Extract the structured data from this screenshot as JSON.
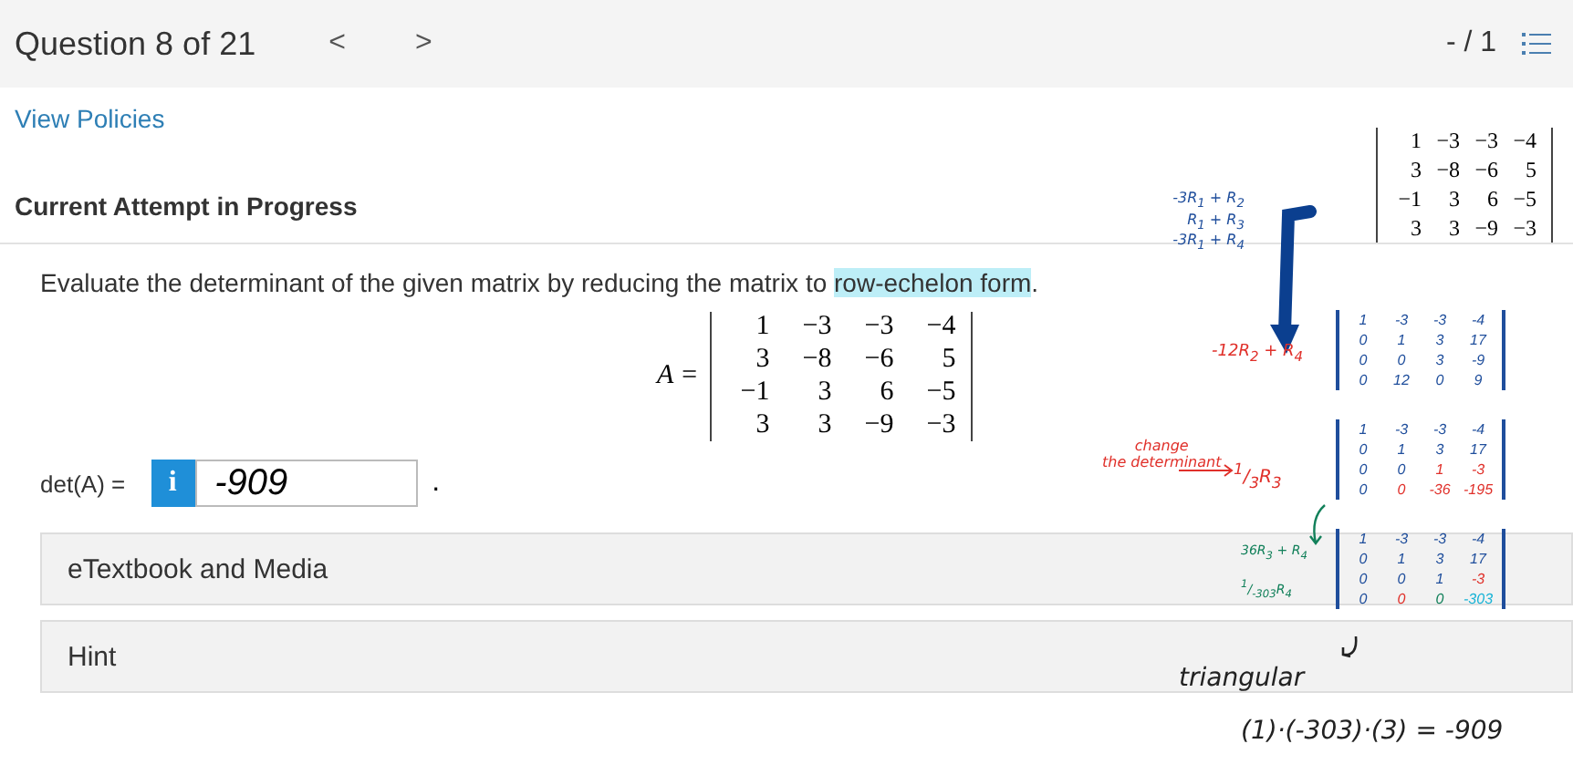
{
  "header": {
    "title": "Question 8 of 21",
    "prev": "<",
    "next": ">",
    "score": "- / 1"
  },
  "policies_link": "View Policies",
  "attempt_heading": "Current Attempt in Progress",
  "question": {
    "before": "Evaluate the determinant of the given matrix by reducing the matrix to ",
    "highlight": "row-echelon form",
    "after": "."
  },
  "matrix": {
    "label": "A =",
    "rows": [
      [
        "1",
        "−3",
        "−3",
        "−4"
      ],
      [
        "3",
        "−8",
        "−6",
        "5"
      ],
      [
        "−1",
        "3",
        "6",
        "−5"
      ],
      [
        "3",
        "3",
        "−9",
        "−3"
      ]
    ]
  },
  "answer": {
    "label": "det(A) =",
    "info": "i",
    "value": "-909",
    "after": "."
  },
  "panels": [
    {
      "label": "eTextbook and Media"
    },
    {
      "label": "Hint"
    }
  ],
  "notes": {
    "start_matrix": {
      "rows": [
        [
          "1",
          "−3",
          "−3",
          "−4"
        ],
        [
          "3",
          "−8",
          "−6",
          "5"
        ],
        [
          "−1",
          "3",
          "6",
          "−5"
        ],
        [
          "3",
          "3",
          "−9",
          "−3"
        ]
      ]
    },
    "ops1": [
      "-3R$_{1}$ + R$_{2}$",
      "R$_{1}$ + R$_{3}$",
      "-3R$_{1}$ + R$_{4}$"
    ],
    "matrix2": {
      "op": "-12R$_{2}$ + R$_{4}$",
      "rows": [
        [
          "1",
          "-3",
          "-3",
          "-4"
        ],
        [
          "0",
          "1",
          "3",
          "17"
        ],
        [
          "0",
          "0",
          "3",
          "-9"
        ],
        [
          "0",
          "12",
          "0",
          "9"
        ]
      ]
    },
    "remark": [
      "change",
      "the determinant"
    ],
    "matrix3": {
      "op": "$^{1}$/$_{3}$R$_{3}$",
      "rows": [
        [
          {
            "v": "1",
            "color": "#1f4e9c"
          },
          {
            "v": "-3",
            "color": "#1f4e9c"
          },
          {
            "v": "-3",
            "color": "#1f4e9c"
          },
          {
            "v": "-4",
            "color": "#1f4e9c"
          }
        ],
        [
          {
            "v": "0",
            "color": "#1f4e9c"
          },
          {
            "v": "1",
            "color": "#1f4e9c"
          },
          {
            "v": "3",
            "color": "#1f4e9c"
          },
          {
            "v": "17",
            "color": "#1f4e9c"
          }
        ],
        [
          {
            "v": "0",
            "color": "#1f4e9c"
          },
          {
            "v": "0",
            "color": "#1f4e9c"
          },
          {
            "v": "1",
            "color": "#e0302a"
          },
          {
            "v": "-3",
            "color": "#e0302a"
          }
        ],
        [
          {
            "v": "0",
            "color": "#1f4e9c"
          },
          {
            "v": "0",
            "color": "#e0302a"
          },
          {
            "v": "-36",
            "color": "#e0302a"
          },
          {
            "v": "-195",
            "color": "#e0302a"
          }
        ]
      ]
    },
    "matrix4": {
      "ops": [
        "36R$_{3}$ + R$_{4}$",
        "$^{1}$/$_{-303}$R$_{4}$"
      ],
      "rows": [
        [
          {
            "v": "1",
            "color": "#1f4e9c"
          },
          {
            "v": "-3",
            "color": "#1f4e9c"
          },
          {
            "v": "-3",
            "color": "#1f4e9c"
          },
          {
            "v": "-4",
            "color": "#1f4e9c"
          }
        ],
        [
          {
            "v": "0",
            "color": "#1f4e9c"
          },
          {
            "v": "1",
            "color": "#1f4e9c"
          },
          {
            "v": "3",
            "color": "#1f4e9c"
          },
          {
            "v": "17",
            "color": "#1f4e9c"
          }
        ],
        [
          {
            "v": "0",
            "color": "#1f4e9c"
          },
          {
            "v": "0",
            "color": "#1f4e9c"
          },
          {
            "v": "1",
            "color": "#1f4e9c"
          },
          {
            "v": "-3",
            "color": "#e0302a"
          }
        ],
        [
          {
            "v": "0",
            "color": "#1f4e9c"
          },
          {
            "v": "0",
            "color": "#e0302a"
          },
          {
            "v": "0",
            "color": "#12805a"
          },
          {
            "v": "-303",
            "color": "#17b3d6"
          }
        ]
      ]
    },
    "conclusion": "triangular",
    "equation": "(1)·(-303)·(3) = -909"
  }
}
